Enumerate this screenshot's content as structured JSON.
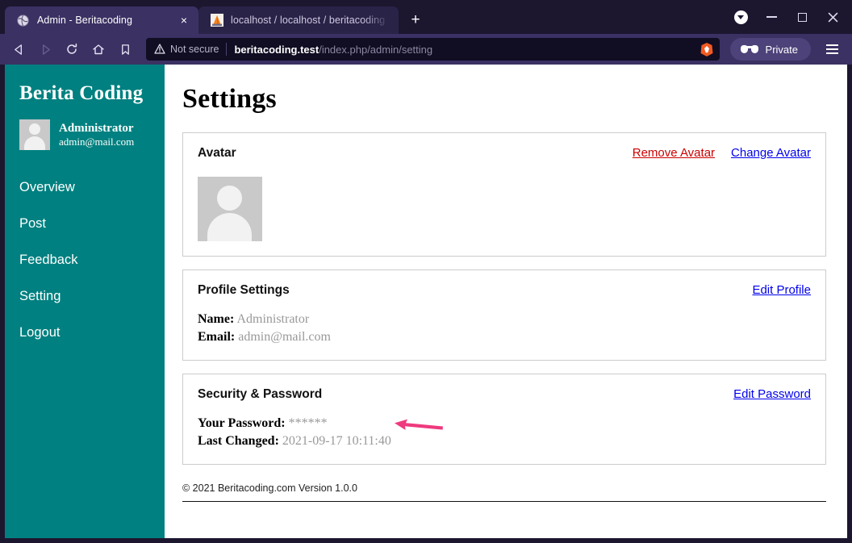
{
  "browser": {
    "tabs": [
      {
        "title": "Admin - Beritacoding",
        "favicon": "globe-icon",
        "active": true,
        "close_label": "×"
      },
      {
        "title": "localhost / localhost / beritacoding",
        "favicon": "phpmyadmin-icon",
        "active": false,
        "close_label": ""
      }
    ],
    "new_tab_label": "+",
    "nav": {
      "back_label": "◁",
      "forward_label": "▷",
      "reload_label": "↻",
      "home_label": "⌂",
      "bookmark_label": "ὑ6"
    },
    "omnibox": {
      "security_icon": "warning-triangle-icon",
      "security_text": "Not secure",
      "url_host": "beritacoding.test",
      "url_path": "/index.php/admin/setting",
      "brave_icon": "brave-lion-icon"
    },
    "private_label": "Private",
    "window_controls": {
      "download_label": "download-indicator",
      "minimize_label": "minimize",
      "maximize_label": "maximize",
      "close_label": "×"
    }
  },
  "sidebar": {
    "brand": "Berita Coding",
    "user": {
      "name": "Administrator",
      "email": "admin@mail.com",
      "avatar": "user-placeholder-icon"
    },
    "items": [
      {
        "label": "Overview"
      },
      {
        "label": "Post"
      },
      {
        "label": "Feedback"
      },
      {
        "label": "Setting"
      },
      {
        "label": "Logout"
      }
    ]
  },
  "main": {
    "page_title": "Settings",
    "avatar_card": {
      "title": "Avatar",
      "remove_label": "Remove Avatar",
      "change_label": "Change Avatar",
      "image": "user-placeholder-icon"
    },
    "profile_card": {
      "title": "Profile Settings",
      "edit_label": "Edit Profile",
      "fields": [
        {
          "label": "Name:",
          "value": "Administrator"
        },
        {
          "label": "Email:",
          "value": "admin@mail.com"
        }
      ]
    },
    "security_card": {
      "title": "Security & Password",
      "edit_label": "Edit Password",
      "fields": [
        {
          "label": "Your Password:",
          "value": "******"
        },
        {
          "label": "Last Changed:",
          "value": "2021-09-17 10:11:40"
        }
      ],
      "annotation": {
        "type": "arrow-left",
        "color": "#ee3a7e"
      }
    },
    "footer": "© 2021 Beritacoding.com Version 1.0.0"
  },
  "colors": {
    "sidebar_teal": "#008080",
    "chrome_dark": "#1c162f",
    "chrome_navbar": "#3b3163",
    "link_blue": "#0000ee",
    "link_red": "#cc0000",
    "annotation_pink": "#ee3a7e"
  }
}
